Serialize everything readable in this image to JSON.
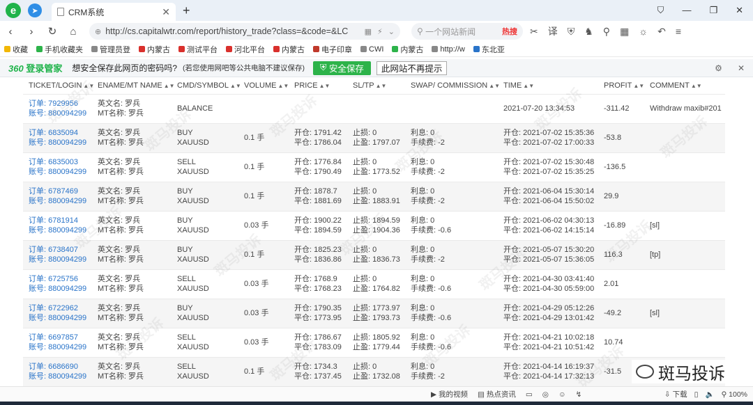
{
  "browser": {
    "tab_title": "CRM系统",
    "url": "http://cs.capitalwtr.com/report/history_trade?class=&code=&LC",
    "search_placeholder": "一个网站新闻",
    "search_hot": "热搜",
    "bookmarks": [
      {
        "label": "收藏",
        "color": "#f2b705"
      },
      {
        "label": "手机收藏夹",
        "color": "#2db34a"
      },
      {
        "label": "管理员登",
        "color": "#888888"
      },
      {
        "label": "内蒙古",
        "color": "#d9302c"
      },
      {
        "label": "测试平台",
        "color": "#d9302c"
      },
      {
        "label": "河北平台",
        "color": "#d9302c"
      },
      {
        "label": "内蒙古",
        "color": "#d9302c"
      },
      {
        "label": "电子印章",
        "color": "#c0392b"
      },
      {
        "label": "CWI",
        "color": "#888888"
      },
      {
        "label": "内蒙古",
        "color": "#2db34a"
      },
      {
        "label": "http://w",
        "color": "#888888"
      },
      {
        "label": "东北亚",
        "color": "#2a74c9"
      }
    ]
  },
  "password_bar": {
    "brand": "360",
    "brand_sub": "登录管家",
    "question": "想安全保存此网页的密码吗?",
    "note": "(若您使用网吧等公共电脑不建议保存)",
    "save_label": "安全保存",
    "never_label": "此网站不再提示"
  },
  "table": {
    "headers": [
      "TICKET/LOGIN",
      "ENAME/MT NAME",
      "CMD/SYMBOL",
      "VOLUME",
      "PRICE",
      "SL/TP",
      "SWAP/ COMMISSION",
      "TIME",
      "PROFIT",
      "COMMENT"
    ],
    "rows": [
      {
        "ticket": "订单: 7929956",
        "login": "账号: 880094299",
        "ename": "英文名: 罗兵",
        "mtname": "MT名称: 罗兵",
        "cmd": "BALANCE",
        "symbol": "",
        "volume": "",
        "open_price": "",
        "close_price": "",
        "sl": "",
        "tp": "",
        "swap": "",
        "commission": "",
        "open_time": "2021-07-20 13:34:53",
        "close_time": "",
        "profit": "-311.42",
        "profit_sign": "pos",
        "comment": "Withdraw maxib#201"
      },
      {
        "ticket": "订单: 6835094",
        "login": "账号: 880094299",
        "ename": "英文名: 罗兵",
        "mtname": "MT名称: 罗兵",
        "cmd": "BUY",
        "symbol": "XAUUSD",
        "volume": "0.1 手",
        "open_price": "开仓: 1791.42",
        "close_price": "平仓: 1786.04",
        "sl": "止损: 0",
        "tp": "止盈: 1797.07",
        "swap": "利息: 0",
        "commission": "手续费: -2",
        "open_time": "开仓: 2021-07-02 15:35:36",
        "close_time": "平仓: 2021-07-02 17:00:33",
        "profit": "-53.8",
        "profit_sign": "neg",
        "comment": ""
      },
      {
        "ticket": "订单: 6835003",
        "login": "账号: 880094299",
        "ename": "英文名: 罗兵",
        "mtname": "MT名称: 罗兵",
        "cmd": "SELL",
        "symbol": "XAUUSD",
        "volume": "0.1 手",
        "open_price": "开仓: 1776.84",
        "close_price": "平仓: 1790.49",
        "sl": "止损: 0",
        "tp": "止盈: 1773.52",
        "swap": "利息: 0",
        "commission": "手续费: -2",
        "open_time": "开仓: 2021-07-02 15:30:48",
        "close_time": "平仓: 2021-07-02 15:35:25",
        "profit": "-136.5",
        "profit_sign": "neg",
        "comment": ""
      },
      {
        "ticket": "订单: 6787469",
        "login": "账号: 880094299",
        "ename": "英文名: 罗兵",
        "mtname": "MT名称: 罗兵",
        "cmd": "BUY",
        "symbol": "XAUUSD",
        "volume": "0.1 手",
        "open_price": "开仓: 1878.7",
        "close_price": "平仓: 1881.69",
        "sl": "止损: 0",
        "tp": "止盈: 1883.91",
        "swap": "利息: 0",
        "commission": "手续费: -2",
        "open_time": "开仓: 2021-06-04 15:30:14",
        "close_time": "平仓: 2021-06-04 15:50:02",
        "profit": "29.9",
        "profit_sign": "pos",
        "comment": ""
      },
      {
        "ticket": "订单: 6781914",
        "login": "账号: 880094299",
        "ename": "英文名: 罗兵",
        "mtname": "MT名称: 罗兵",
        "cmd": "BUY",
        "symbol": "XAUUSD",
        "volume": "0.03 手",
        "open_price": "开仓: 1900.22",
        "close_price": "平仓: 1894.59",
        "sl": "止损: 1894.59",
        "tp": "止盈: 1904.36",
        "swap": "利息: 0",
        "commission": "手续费: -0.6",
        "open_time": "开仓: 2021-06-02 04:30:13",
        "close_time": "平仓: 2021-06-02 14:15:14",
        "profit": "-16.89",
        "profit_sign": "neg",
        "comment": "[sl]"
      },
      {
        "ticket": "订单: 6738407",
        "login": "账号: 880094299",
        "ename": "英文名: 罗兵",
        "mtname": "MT名称: 罗兵",
        "cmd": "BUY",
        "symbol": "XAUUSD",
        "volume": "0.1 手",
        "open_price": "开仓: 1825.23",
        "close_price": "平仓: 1836.86",
        "sl": "止损: 0",
        "tp": "止盈: 1836.73",
        "swap": "利息: 0",
        "commission": "手续费: -2",
        "open_time": "开仓: 2021-05-07 15:30:20",
        "close_time": "平仓: 2021-05-07 15:36:05",
        "profit": "116.3",
        "profit_sign": "pos",
        "comment": "[tp]"
      },
      {
        "ticket": "订单: 6725756",
        "login": "账号: 880094299",
        "ename": "英文名: 罗兵",
        "mtname": "MT名称: 罗兵",
        "cmd": "SELL",
        "symbol": "XAUUSD",
        "volume": "0.03 手",
        "open_price": "开仓: 1768.9",
        "close_price": "平仓: 1768.23",
        "sl": "止损: 0",
        "tp": "止盈: 1764.82",
        "swap": "利息: 0",
        "commission": "手续费: -0.6",
        "open_time": "开仓: 2021-04-30 03:41:40",
        "close_time": "平仓: 2021-04-30 05:59:00",
        "profit": "2.01",
        "profit_sign": "pos",
        "comment": ""
      },
      {
        "ticket": "订单: 6722962",
        "login": "账号: 880094299",
        "ename": "英文名: 罗兵",
        "mtname": "MT名称: 罗兵",
        "cmd": "BUY",
        "symbol": "XAUUSD",
        "volume": "0.03 手",
        "open_price": "开仓: 1790.35",
        "close_price": "平仓: 1773.95",
        "sl": "止损: 1773.97",
        "tp": "止盈: 1793.73",
        "swap": "利息: 0",
        "commission": "手续费: -0.6",
        "open_time": "开仓: 2021-04-29 05:12:26",
        "close_time": "平仓: 2021-04-29 13:01:42",
        "profit": "-49.2",
        "profit_sign": "neg",
        "comment": "[sl]"
      },
      {
        "ticket": "订单: 6697857",
        "login": "账号: 880094299",
        "ename": "英文名: 罗兵",
        "mtname": "MT名称: 罗兵",
        "cmd": "SELL",
        "symbol": "XAUUSD",
        "volume": "0.03 手",
        "open_price": "开仓: 1786.67",
        "close_price": "平仓: 1783.09",
        "sl": "止损: 1805.92",
        "tp": "止盈: 1779.44",
        "swap": "利息: 0",
        "commission": "手续费: -0.6",
        "open_time": "开仓: 2021-04-21 10:02:18",
        "close_time": "平仓: 2021-04-21 10:51:42",
        "profit": "10.74",
        "profit_sign": "pos",
        "comment": ""
      },
      {
        "ticket": "订单: 6686690",
        "login": "账号: 880094299",
        "ename": "英文名: 罗兵",
        "mtname": "MT名称: 罗兵",
        "cmd": "SELL",
        "symbol": "XAUUSD",
        "volume": "0.1 手",
        "open_price": "开仓: 1734.3",
        "close_price": "平仓: 1737.45",
        "sl": "止损: 0",
        "tp": "止盈: 1732.08",
        "swap": "利息: 0",
        "commission": "手续费: -2",
        "open_time": "开仓: 2021-04-14 16:19:37",
        "close_time": "平仓: 2021-04-14 17:32:13",
        "profit": "-31.5",
        "profit_sign": "neg",
        "comment": ""
      }
    ]
  },
  "watermark": {
    "text": "斑马投诉"
  },
  "status": {
    "items_left": [
      "我的视频",
      "热点资讯"
    ],
    "download_label": "下载",
    "zoom": "100%"
  }
}
